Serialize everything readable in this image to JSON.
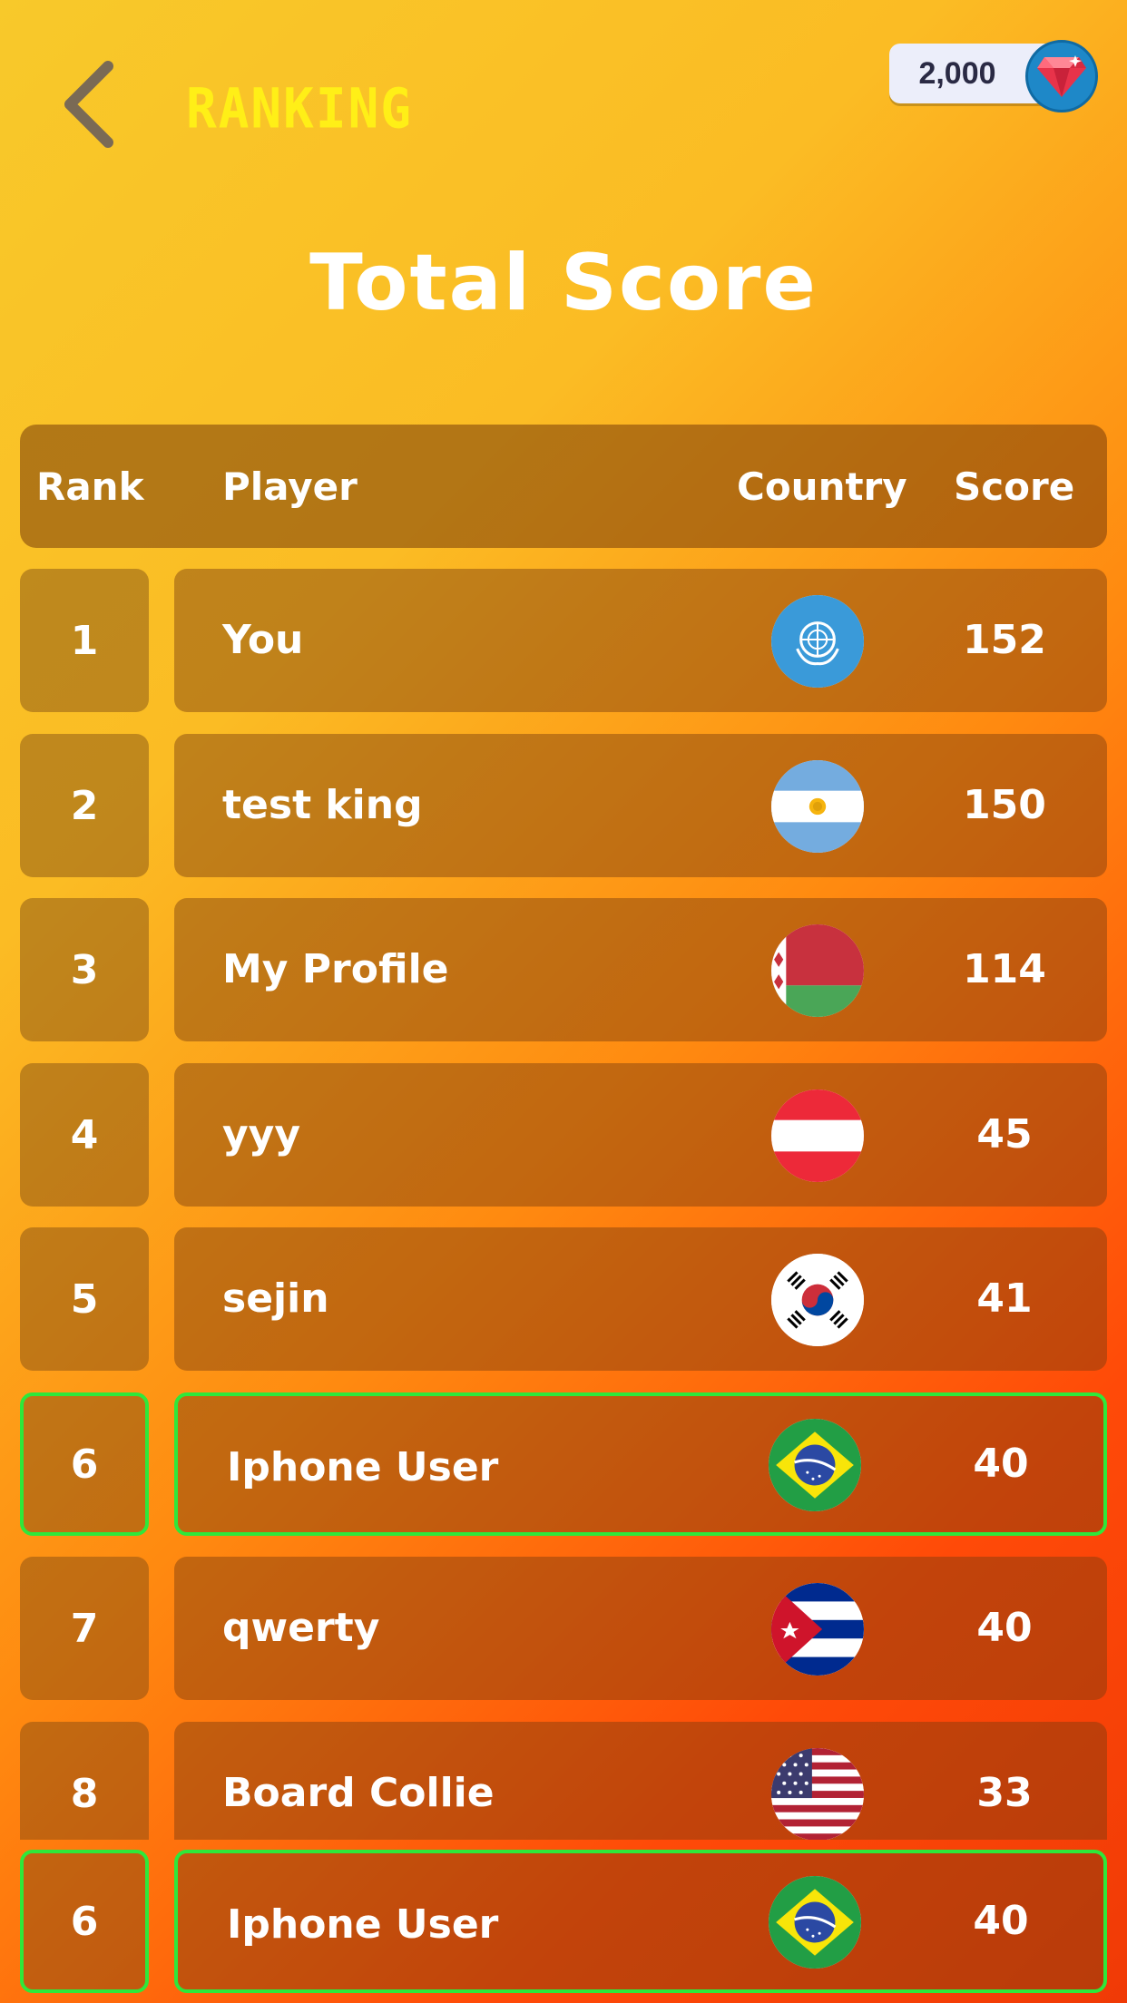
{
  "topbar": {
    "back_icon": "back-chevron-icon",
    "title": "RANKING",
    "gems": "2,000",
    "gem_icon": "ruby-gem-icon"
  },
  "page_title": "Total Score",
  "table": {
    "headers": {
      "rank": "Rank",
      "player": "Player",
      "country": "Country",
      "score": "Score"
    },
    "rows": [
      {
        "rank": "1",
        "player": "You",
        "country_icon": "united-nations-flag-icon",
        "score": "152"
      },
      {
        "rank": "2",
        "player": "test king",
        "country_icon": "argentina-flag-icon",
        "score": "150"
      },
      {
        "rank": "3",
        "player": "My Profile",
        "country_icon": "belarus-flag-icon",
        "score": "114"
      },
      {
        "rank": "4",
        "player": "yyy",
        "country_icon": "austria-flag-icon",
        "score": "45"
      },
      {
        "rank": "5",
        "player": "sejin",
        "country_icon": "south-korea-flag-icon",
        "score": "41"
      },
      {
        "rank": "6",
        "player": "Iphone User",
        "country_icon": "brazil-flag-icon",
        "score": "40",
        "highlight": true
      },
      {
        "rank": "7",
        "player": "qwerty",
        "country_icon": "cuba-flag-icon",
        "score": "40"
      },
      {
        "rank": "8",
        "player": "Board Collie",
        "country_icon": "usa-flag-icon",
        "score": "33"
      }
    ],
    "current_user": {
      "rank": "6",
      "player": "Iphone User",
      "country_icon": "brazil-flag-icon",
      "score": "40"
    }
  },
  "colors": {
    "highlight_border": "#2ee83a",
    "title_yellow": "#ffef17"
  }
}
